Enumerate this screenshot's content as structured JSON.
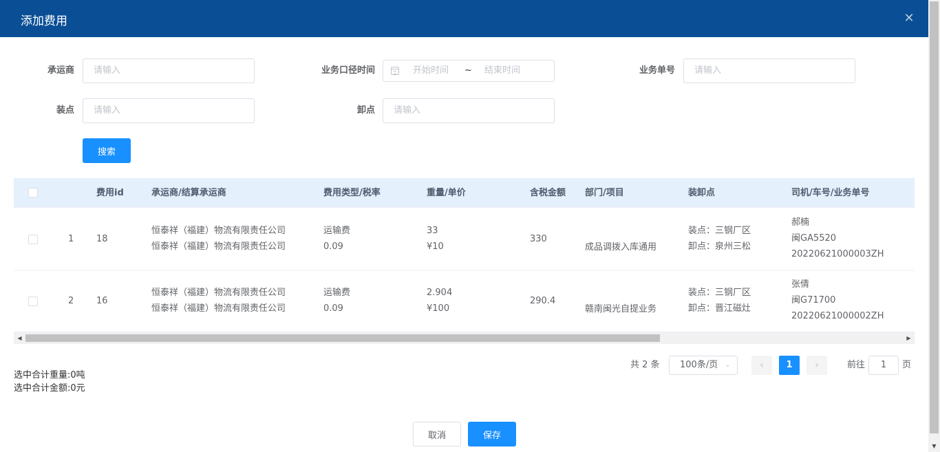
{
  "dialog": {
    "title": "添加费用",
    "close_icon": "close-icon"
  },
  "filters": {
    "carrier_label": "承运商",
    "carrier_placeholder": "请输入",
    "biz_time_label": "业务口径时间",
    "start_placeholder": "开始时间",
    "range_sep": "~",
    "end_placeholder": "结束时间",
    "biz_no_label": "业务单号",
    "biz_no_placeholder": "请输入",
    "load_label": "装点",
    "load_placeholder": "请输入",
    "unload_label": "卸点",
    "unload_placeholder": "请输入",
    "search_button": "搜索"
  },
  "table": {
    "columns": [
      "费用id",
      "承运商/结算承运商",
      "费用类型/税率",
      "重量/单价",
      "含税金额",
      "部门/项目",
      "装卸点",
      "司机/车号/业务单号"
    ],
    "rows": [
      {
        "index": "1",
        "fee_id": "18",
        "carrier": "恒泰祥（福建）物流有限责任公司",
        "settle_carrier": "恒泰祥（福建）物流有限责任公司",
        "fee_type": "运输费",
        "tax_rate": "0.09",
        "weight": "33",
        "unit_price": "¥10",
        "amount": "330",
        "dept": "",
        "project": "成品调拨入库通用",
        "load_point": "装点：三钢厂区",
        "unload_point": "卸点：泉州三松",
        "driver": "郝楠",
        "plate": "闽GA5520",
        "biz_no": "20220621000003ZH"
      },
      {
        "index": "2",
        "fee_id": "16",
        "carrier": "恒泰祥（福建）物流有限责任公司",
        "settle_carrier": "恒泰祥（福建）物流有限责任公司",
        "fee_type": "运输费",
        "tax_rate": "0.09",
        "weight": "2.904",
        "unit_price": "¥100",
        "amount": "290.4",
        "dept": "",
        "project": "赣南闽光自提业务",
        "load_point": "装点：三钢厂区",
        "unload_point": "卸点：晋江磁灶",
        "driver": "张倩",
        "plate": "闽G71700",
        "biz_no": "20220621000002ZH"
      }
    ]
  },
  "pagination": {
    "total": "共 2 条",
    "page_size": "100条/页",
    "current_page": "1",
    "goto_label": "前往",
    "goto_value": "1",
    "page_unit": "页"
  },
  "summary": {
    "weight": "选中合计重量:0吨",
    "amount": "选中合计金额:0元"
  },
  "footer": {
    "cancel": "取消",
    "save": "保存"
  },
  "colors": {
    "header_bg": "#0a4f96",
    "primary": "#1890ff",
    "table_head_bg": "#e4f0fb"
  }
}
